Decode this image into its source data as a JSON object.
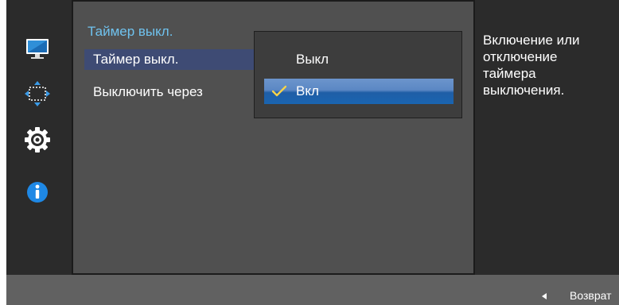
{
  "menu": {
    "section_title": "Таймер выкл.",
    "items": [
      {
        "label": "Таймер выкл."
      },
      {
        "label": "Выключить через"
      }
    ]
  },
  "dropdown": {
    "options": [
      {
        "label": "Выкл",
        "selected": false
      },
      {
        "label": "Вкл",
        "selected": true
      }
    ]
  },
  "help": {
    "text": "Включение или\nотключение\nтаймера\nвыключения."
  },
  "footer": {
    "back_label": "Возврат"
  },
  "icons": [
    "monitor-icon",
    "size-position-icon",
    "system-gear-icon",
    "info-icon",
    "check-icon",
    "back-arrow-icon"
  ],
  "colors": {
    "accent_title": "#6fc2ee",
    "selected_row": "#3e4b74",
    "selected_option": "#1a64b0",
    "check": "#f5d24b"
  }
}
